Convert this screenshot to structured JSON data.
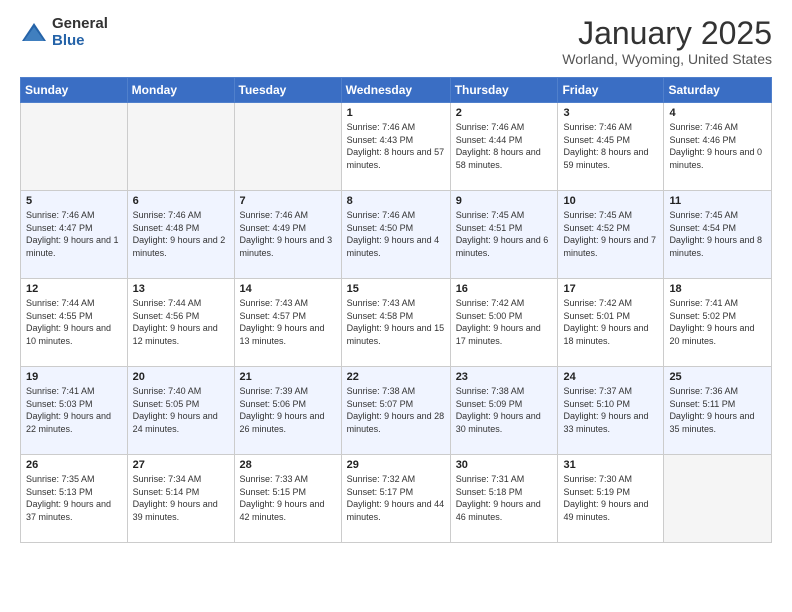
{
  "logo": {
    "general": "General",
    "blue": "Blue"
  },
  "header": {
    "month": "January 2025",
    "location": "Worland, Wyoming, United States"
  },
  "weekdays": [
    "Sunday",
    "Monday",
    "Tuesday",
    "Wednesday",
    "Thursday",
    "Friday",
    "Saturday"
  ],
  "weeks": [
    [
      {
        "day": "",
        "empty": true
      },
      {
        "day": "",
        "empty": true
      },
      {
        "day": "",
        "empty": true
      },
      {
        "day": "1",
        "sunrise": "7:46 AM",
        "sunset": "4:43 PM",
        "daylight": "8 hours and 57 minutes."
      },
      {
        "day": "2",
        "sunrise": "7:46 AM",
        "sunset": "4:44 PM",
        "daylight": "8 hours and 58 minutes."
      },
      {
        "day": "3",
        "sunrise": "7:46 AM",
        "sunset": "4:45 PM",
        "daylight": "8 hours and 59 minutes."
      },
      {
        "day": "4",
        "sunrise": "7:46 AM",
        "sunset": "4:46 PM",
        "daylight": "9 hours and 0 minutes."
      }
    ],
    [
      {
        "day": "5",
        "sunrise": "7:46 AM",
        "sunset": "4:47 PM",
        "daylight": "9 hours and 1 minute."
      },
      {
        "day": "6",
        "sunrise": "7:46 AM",
        "sunset": "4:48 PM",
        "daylight": "9 hours and 2 minutes."
      },
      {
        "day": "7",
        "sunrise": "7:46 AM",
        "sunset": "4:49 PM",
        "daylight": "9 hours and 3 minutes."
      },
      {
        "day": "8",
        "sunrise": "7:46 AM",
        "sunset": "4:50 PM",
        "daylight": "9 hours and 4 minutes."
      },
      {
        "day": "9",
        "sunrise": "7:45 AM",
        "sunset": "4:51 PM",
        "daylight": "9 hours and 6 minutes."
      },
      {
        "day": "10",
        "sunrise": "7:45 AM",
        "sunset": "4:52 PM",
        "daylight": "9 hours and 7 minutes."
      },
      {
        "day": "11",
        "sunrise": "7:45 AM",
        "sunset": "4:54 PM",
        "daylight": "9 hours and 8 minutes."
      }
    ],
    [
      {
        "day": "12",
        "sunrise": "7:44 AM",
        "sunset": "4:55 PM",
        "daylight": "9 hours and 10 minutes."
      },
      {
        "day": "13",
        "sunrise": "7:44 AM",
        "sunset": "4:56 PM",
        "daylight": "9 hours and 12 minutes."
      },
      {
        "day": "14",
        "sunrise": "7:43 AM",
        "sunset": "4:57 PM",
        "daylight": "9 hours and 13 minutes."
      },
      {
        "day": "15",
        "sunrise": "7:43 AM",
        "sunset": "4:58 PM",
        "daylight": "9 hours and 15 minutes."
      },
      {
        "day": "16",
        "sunrise": "7:42 AM",
        "sunset": "5:00 PM",
        "daylight": "9 hours and 17 minutes."
      },
      {
        "day": "17",
        "sunrise": "7:42 AM",
        "sunset": "5:01 PM",
        "daylight": "9 hours and 18 minutes."
      },
      {
        "day": "18",
        "sunrise": "7:41 AM",
        "sunset": "5:02 PM",
        "daylight": "9 hours and 20 minutes."
      }
    ],
    [
      {
        "day": "19",
        "sunrise": "7:41 AM",
        "sunset": "5:03 PM",
        "daylight": "9 hours and 22 minutes."
      },
      {
        "day": "20",
        "sunrise": "7:40 AM",
        "sunset": "5:05 PM",
        "daylight": "9 hours and 24 minutes."
      },
      {
        "day": "21",
        "sunrise": "7:39 AM",
        "sunset": "5:06 PM",
        "daylight": "9 hours and 26 minutes."
      },
      {
        "day": "22",
        "sunrise": "7:38 AM",
        "sunset": "5:07 PM",
        "daylight": "9 hours and 28 minutes."
      },
      {
        "day": "23",
        "sunrise": "7:38 AM",
        "sunset": "5:09 PM",
        "daylight": "9 hours and 30 minutes."
      },
      {
        "day": "24",
        "sunrise": "7:37 AM",
        "sunset": "5:10 PM",
        "daylight": "9 hours and 33 minutes."
      },
      {
        "day": "25",
        "sunrise": "7:36 AM",
        "sunset": "5:11 PM",
        "daylight": "9 hours and 35 minutes."
      }
    ],
    [
      {
        "day": "26",
        "sunrise": "7:35 AM",
        "sunset": "5:13 PM",
        "daylight": "9 hours and 37 minutes."
      },
      {
        "day": "27",
        "sunrise": "7:34 AM",
        "sunset": "5:14 PM",
        "daylight": "9 hours and 39 minutes."
      },
      {
        "day": "28",
        "sunrise": "7:33 AM",
        "sunset": "5:15 PM",
        "daylight": "9 hours and 42 minutes."
      },
      {
        "day": "29",
        "sunrise": "7:32 AM",
        "sunset": "5:17 PM",
        "daylight": "9 hours and 44 minutes."
      },
      {
        "day": "30",
        "sunrise": "7:31 AM",
        "sunset": "5:18 PM",
        "daylight": "9 hours and 46 minutes."
      },
      {
        "day": "31",
        "sunrise": "7:30 AM",
        "sunset": "5:19 PM",
        "daylight": "9 hours and 49 minutes."
      },
      {
        "day": "",
        "empty": true
      }
    ]
  ]
}
